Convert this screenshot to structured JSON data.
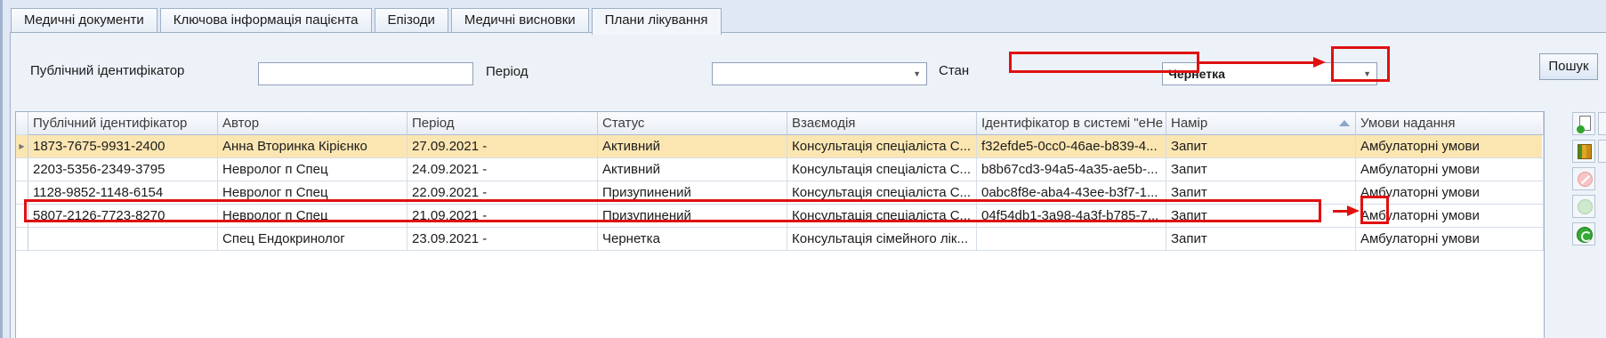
{
  "tabs": [
    {
      "label": "Медичні документи"
    },
    {
      "label": "Ключова інформація пацієнта"
    },
    {
      "label": "Епізоди"
    },
    {
      "label": "Медичні висновки"
    },
    {
      "label": "Плани лікування",
      "active": true
    }
  ],
  "search": {
    "public_id_label": "Публічний ідентифікатор",
    "public_id_value": "",
    "period_label": "Період",
    "period_value": "",
    "status_label": "Стан",
    "status_value": "Чернетка",
    "search_button": "Пошук"
  },
  "grid": {
    "columns": [
      "Публічний ідентифікатор",
      "Автор",
      "Період",
      "Статус",
      "Взаємодія",
      "Ідентифікатор в системі \"eHe",
      "Намір",
      "Умови надання"
    ],
    "sorted_column": "Намір",
    "rows": [
      {
        "public_id": "1873-7675-9931-2400",
        "author": "Анна Вторинка Кірієнко",
        "period": "27.09.2021 -",
        "status": "Активний",
        "interaction": "Консультація спеціаліста С...",
        "ehealth_id": "f32efde5-0cc0-46ae-b839-4...",
        "intent": "Запит",
        "conditions": "Амбулаторні умови",
        "selected": true
      },
      {
        "public_id": "2203-5356-2349-3795",
        "author": "Невролог п Спец",
        "period": "24.09.2021 -",
        "status": "Активний",
        "interaction": "Консультація спеціаліста С...",
        "ehealth_id": "b8b67cd3-94a5-4a35-ae5b-...",
        "intent": "Запит",
        "conditions": "Амбулаторні умови"
      },
      {
        "public_id": "1128-9852-1148-6154",
        "author": "Невролог п Спец",
        "period": "22.09.2021 -",
        "status": "Призупинений",
        "interaction": "Консультація спеціаліста С...",
        "ehealth_id": "0abc8f8e-aba4-43ee-b3f7-1...",
        "intent": "Запит",
        "conditions": "Амбулаторні умови"
      },
      {
        "public_id": "5807-2126-7723-8270",
        "author": "Невролог п Спец",
        "period": "21.09.2021 -",
        "status": "Призупинений",
        "interaction": "Консультація спеціаліста С...",
        "ehealth_id": "04f54db1-3a98-4a3f-b785-7...",
        "intent": "Запит",
        "conditions": "Амбулаторні умови"
      },
      {
        "public_id": "",
        "author": "Спец Ендокринолог",
        "period": "23.09.2021 -",
        "status": "Чернетка",
        "interaction": "Консультація сімейного лік...",
        "ehealth_id": "",
        "intent": "Запит",
        "conditions": "Амбулаторні умови",
        "highlighted": true
      }
    ]
  },
  "toolbar": {
    "buttons": [
      "new-document-icon",
      "books-icon",
      "cancel-icon",
      "refresh-icon",
      "refresh-icon"
    ]
  },
  "colors": {
    "highlight": "#e01010",
    "selected_row": "#fbe6b2",
    "panel_bg": "#edf2f9"
  }
}
